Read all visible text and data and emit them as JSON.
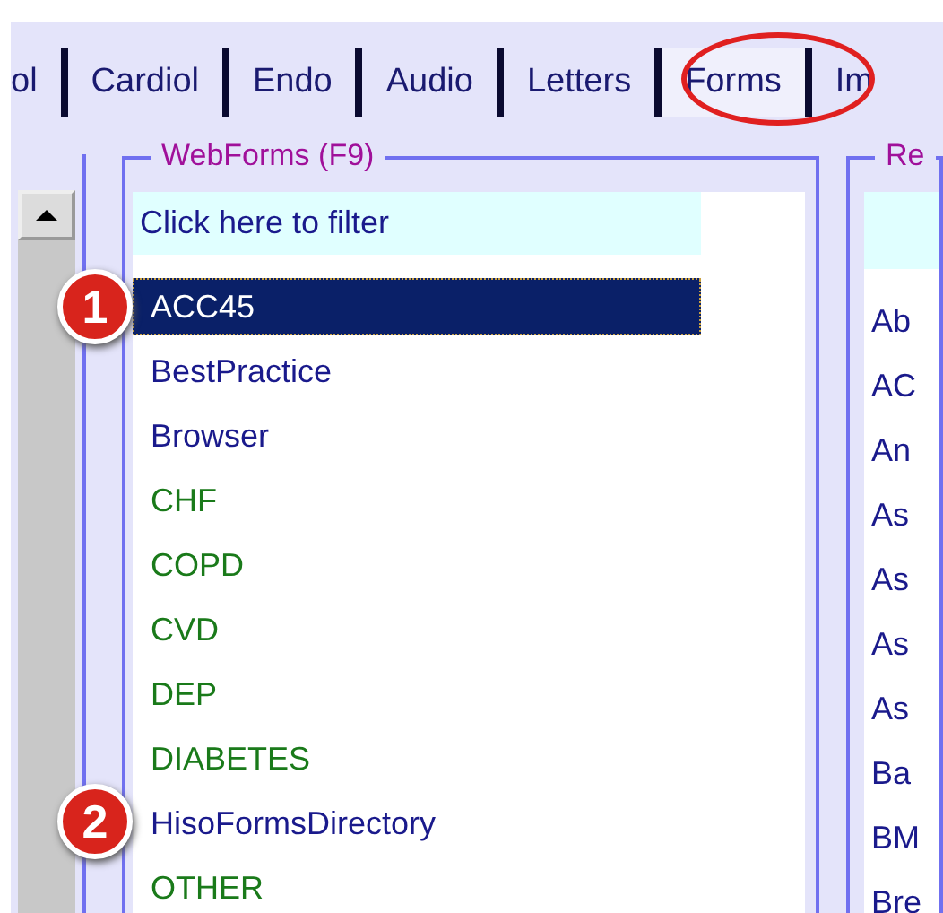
{
  "tabs": [
    {
      "label": "ol",
      "selected": false
    },
    {
      "label": "Cardiol",
      "selected": false
    },
    {
      "label": "Endo",
      "selected": false
    },
    {
      "label": "Audio",
      "selected": false
    },
    {
      "label": "Letters",
      "selected": false
    },
    {
      "label": "Forms",
      "selected": true
    },
    {
      "label": "Im",
      "selected": false
    }
  ],
  "webforms": {
    "title": "WebForms (F9)",
    "filter": {
      "placeholder": "Click here to filter"
    },
    "items": [
      {
        "label": "ACC45",
        "selected": true
      },
      {
        "label": "BestPractice",
        "color": "#1a1a8c",
        "selected": false
      },
      {
        "label": "Browser",
        "color": "#1a1a8c",
        "selected": false
      },
      {
        "label": "CHF",
        "color": "#1a7a1a",
        "selected": false
      },
      {
        "label": "COPD",
        "color": "#1a7a1a",
        "selected": false
      },
      {
        "label": "CVD",
        "color": "#1a7a1a",
        "selected": false
      },
      {
        "label": "DEP",
        "color": "#1a7a1a",
        "selected": false
      },
      {
        "label": "DIABETES",
        "color": "#1a7a1a",
        "selected": false
      },
      {
        "label": "HisoFormsDirectory",
        "color": "#1a1a8c",
        "selected": false
      },
      {
        "label": "OTHER",
        "color": "#1a7a1a",
        "selected": false
      }
    ]
  },
  "right_panel": {
    "title": "Re",
    "items": [
      "Ab",
      "AC",
      "An",
      "As",
      "As",
      "As",
      "As",
      "Ba",
      "BM",
      "Bre"
    ]
  },
  "callouts": [
    "1",
    "2"
  ]
}
